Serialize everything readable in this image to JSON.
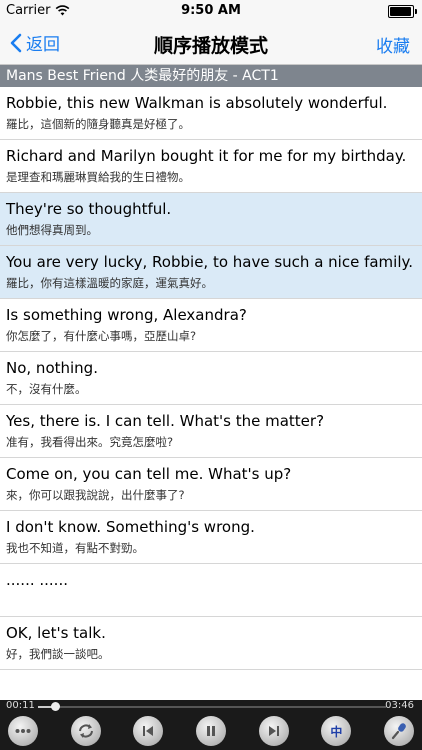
{
  "status": {
    "carrier": "Carrier",
    "time": "9:50 AM",
    "battery_fraction": 0.95
  },
  "nav": {
    "back_label": "返回",
    "title": "順序播放模式",
    "favorite_label": "收藏"
  },
  "lesson": {
    "title": "Mans Best Friend 人类最好的朋友 - ACT1"
  },
  "rows": [
    {
      "en": "Robbie, this new Walkman is absolutely wonderful.",
      "zh": "羅比，這個新的隨身聽真是好極了。",
      "highlight": false
    },
    {
      "en": "Richard and Marilyn bought it for me for my birthday.",
      "zh": "是理查和瑪麗琳買給我的生日禮物。",
      "highlight": false
    },
    {
      "en": "They're so thoughtful.",
      "zh": "他們想得真周到。",
      "highlight": true
    },
    {
      "en": "You are very lucky, Robbie, to have such a nice family.",
      "zh": "羅比，你有這樣溫暖的家庭，運氣真好。",
      "highlight": true
    },
    {
      "en": "Is something wrong, Alexandra?",
      "zh": "你怎麼了，有什麼心事嗎，亞歷山卓?",
      "highlight": false
    },
    {
      "en": "No, nothing.",
      "zh": "不，沒有什麼。",
      "highlight": false
    },
    {
      "en": "Yes, there is. I can tell.  What's the matter?",
      "zh": "准有，我看得出來。究竟怎麼啦?",
      "highlight": false
    },
    {
      "en": "Come on, you can tell me. What's up?",
      "zh": "來，你可以跟我說說，出什麼事了?",
      "highlight": false
    },
    {
      "en": "I don't know. Something's wrong.",
      "zh": "我也不知道，有點不對勁。",
      "highlight": false
    },
    {
      "en": "...... ......",
      "zh": "",
      "highlight": false
    },
    {
      "en": "OK, let's talk.",
      "zh": "好，我們談一談吧。",
      "highlight": false
    }
  ],
  "player": {
    "elapsed": "00:11",
    "total": "03:46",
    "progress_fraction": 0.05,
    "controls": [
      {
        "name": "more-button",
        "icon": "ellipsis-icon",
        "label": ""
      },
      {
        "name": "repeat-button",
        "icon": "repeat-icon",
        "label": ""
      },
      {
        "name": "previous-button",
        "icon": "previous-icon",
        "label": ""
      },
      {
        "name": "pause-button",
        "icon": "pause-icon",
        "label": ""
      },
      {
        "name": "next-button",
        "icon": "next-icon",
        "label": ""
      },
      {
        "name": "chinese-toggle-button",
        "icon": "chinese-text-icon",
        "label": "中"
      },
      {
        "name": "record-button",
        "icon": "microphone-icon",
        "label": ""
      }
    ]
  },
  "colors": {
    "accent": "#1a7df0",
    "header": "#7e858e",
    "highlight": "#daeaf7",
    "player": "#1a1a1a"
  }
}
